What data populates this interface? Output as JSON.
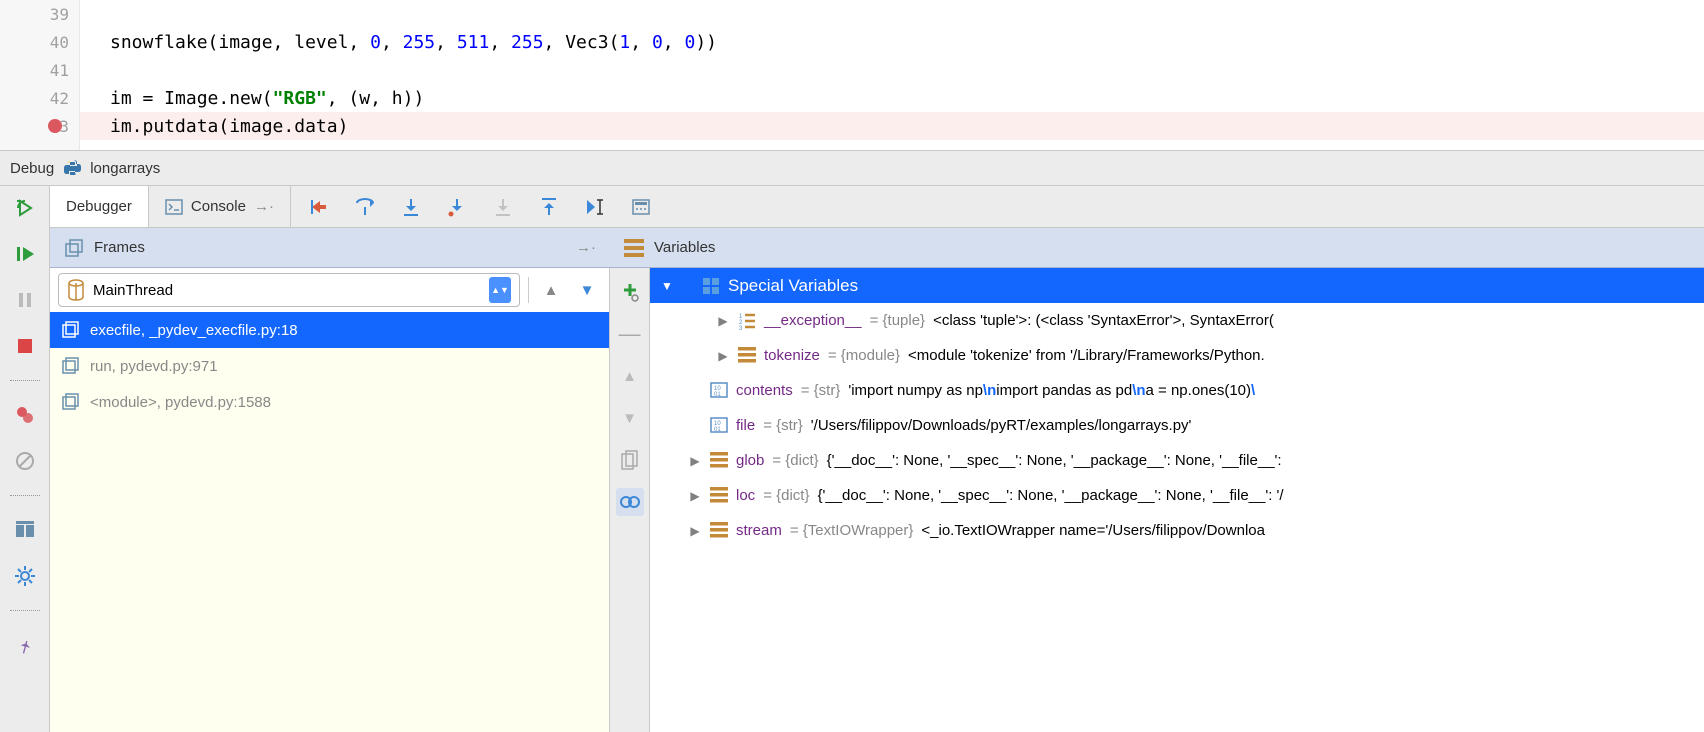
{
  "editor": {
    "lines": [
      {
        "num": "39",
        "parts": []
      },
      {
        "num": "40",
        "parts": [
          {
            "t": "snowflake(image, level, ",
            "c": ""
          },
          {
            "t": "0",
            "c": "kw-num"
          },
          {
            "t": ", ",
            "c": ""
          },
          {
            "t": "255",
            "c": "kw-num"
          },
          {
            "t": ", ",
            "c": ""
          },
          {
            "t": "511",
            "c": "kw-num"
          },
          {
            "t": ", ",
            "c": ""
          },
          {
            "t": "255",
            "c": "kw-num"
          },
          {
            "t": ", Vec3(",
            "c": ""
          },
          {
            "t": "1",
            "c": "kw-num"
          },
          {
            "t": ", ",
            "c": ""
          },
          {
            "t": "0",
            "c": "kw-num"
          },
          {
            "t": ", ",
            "c": ""
          },
          {
            "t": "0",
            "c": "kw-num"
          },
          {
            "t": "))",
            "c": ""
          }
        ]
      },
      {
        "num": "41",
        "parts": []
      },
      {
        "num": "42",
        "parts": [
          {
            "t": "im = Image.new(",
            "c": ""
          },
          {
            "t": "\"RGB\"",
            "c": "kw-str"
          },
          {
            "t": ", (w, h))",
            "c": ""
          }
        ]
      },
      {
        "num": "43",
        "bp": true,
        "hl": true,
        "parts": [
          {
            "t": "im.putdata(image.data)",
            "c": ""
          }
        ]
      }
    ]
  },
  "debug_bar": {
    "label": "Debug",
    "config": "longarrays"
  },
  "tabs": {
    "debugger": "Debugger",
    "console": "Console"
  },
  "frames": {
    "header": "Frames",
    "thread": "MainThread",
    "items": [
      {
        "label": "execfile, _pydev_execfile.py:18",
        "sel": true
      },
      {
        "label": "run, pydevd.py:971",
        "sel": false
      },
      {
        "label": "<module>, pydevd.py:1588",
        "sel": false
      }
    ]
  },
  "variables": {
    "header": "Variables",
    "special_header": "Special Variables",
    "items": [
      {
        "indent": 2,
        "tri": "r",
        "icon": "list",
        "name": "__exception__",
        "type": "{tuple}",
        "val": " <class 'tuple'>: (<class 'SyntaxError'>, SyntaxError("
      },
      {
        "indent": 2,
        "tri": "r",
        "icon": "bars",
        "name": "tokenize",
        "type": "{module}",
        "val": " <module 'tokenize' from '/Library/Frameworks/Python."
      },
      {
        "indent": 1,
        "tri": "",
        "icon": "bin",
        "name": "contents",
        "type": "{str}",
        "val_parts": [
          {
            "t": " 'import numpy as np",
            "c": ""
          },
          {
            "t": "\\n",
            "c": "esc"
          },
          {
            "t": "import pandas as pd",
            "c": ""
          },
          {
            "t": "\\n",
            "c": "esc"
          },
          {
            "t": "a = np.ones(10)",
            "c": ""
          },
          {
            "t": "\\",
            "c": "esc"
          }
        ]
      },
      {
        "indent": 1,
        "tri": "",
        "icon": "bin",
        "name": "file",
        "type": "{str}",
        "val": " '/Users/filippov/Downloads/pyRT/examples/longarrays.py'"
      },
      {
        "indent": 1,
        "tri": "r",
        "icon": "bars",
        "name": "glob",
        "type": "{dict}",
        "val": " {'__doc__': None, '__spec__': None, '__package__': None, '__file__': "
      },
      {
        "indent": 1,
        "tri": "r",
        "icon": "bars",
        "name": "loc",
        "type": "{dict}",
        "val": " {'__doc__': None, '__spec__': None, '__package__': None, '__file__': '/"
      },
      {
        "indent": 1,
        "tri": "r",
        "icon": "bars",
        "name": "stream",
        "type": "{TextIOWrapper}",
        "val": " <_io.TextIOWrapper name='/Users/filippov/Downloa"
      }
    ]
  }
}
